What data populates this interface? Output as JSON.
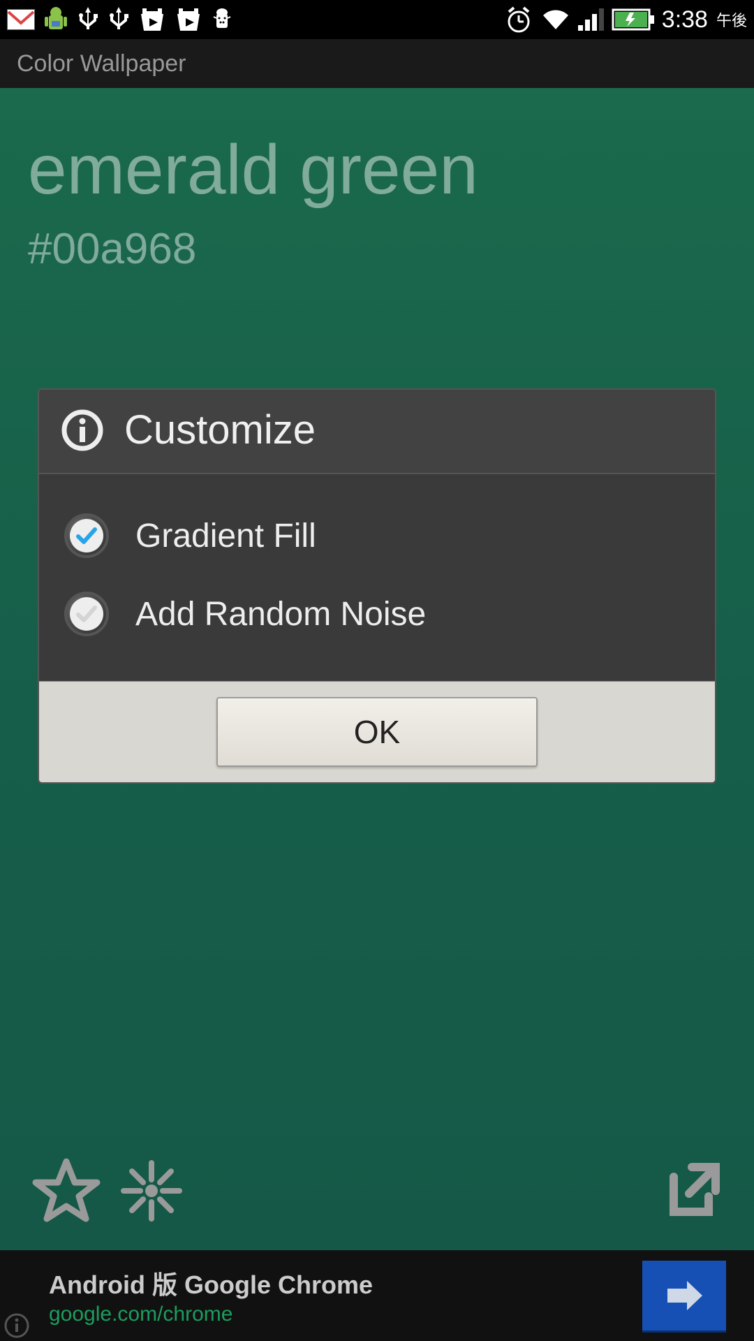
{
  "status": {
    "time": "3:38",
    "ampm": "午後"
  },
  "app": {
    "title": "Color Wallpaper"
  },
  "color": {
    "name": "emerald green",
    "hex": "#00a968",
    "bg": "#1b6a4d"
  },
  "dialog": {
    "title": "Customize",
    "options": [
      {
        "label": "Gradient Fill",
        "checked": true
      },
      {
        "label": "Add Random Noise",
        "checked": false
      }
    ],
    "ok": "OK"
  },
  "ad": {
    "title": "Android 版 Google Chrome",
    "url": "google.com/chrome"
  }
}
